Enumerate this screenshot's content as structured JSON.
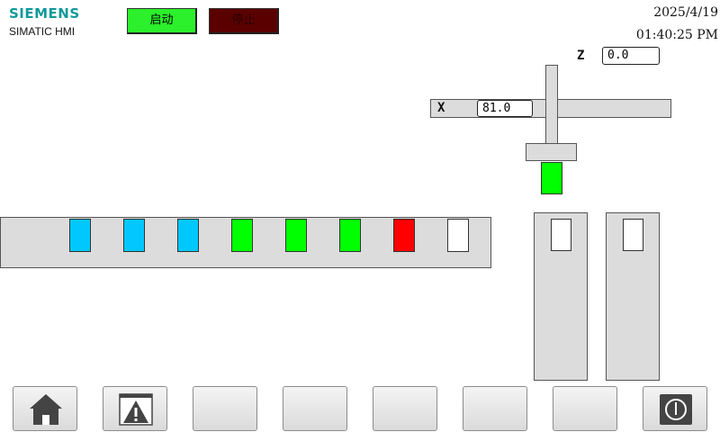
{
  "header": {
    "brand": "SIEMENS",
    "subbrand": "SIMATIC HMI",
    "start_label": "启动",
    "stop_label": "停止",
    "date": "2025/4/19",
    "time": "01:40:25 PM"
  },
  "axes": {
    "z_label": "Z",
    "z_value": "0.0",
    "x_label": "X",
    "x_value": "81.0"
  },
  "conveyor": {
    "items": [
      {
        "color": "#00c8ff"
      },
      {
        "color": "#00c8ff"
      },
      {
        "color": "#00c8ff"
      },
      {
        "color": "#00ff00"
      },
      {
        "color": "#00ff00"
      },
      {
        "color": "#00ff00"
      },
      {
        "color": "#ff0000"
      },
      {
        "color": "#ffffff"
      }
    ]
  },
  "gripper": {
    "held_color": "#00ff00"
  },
  "bins": [
    {
      "slot_color": "#ffffff"
    },
    {
      "slot_color": "#ffffff"
    }
  ],
  "nav": {
    "buttons": [
      {
        "icon": "home-icon"
      },
      {
        "icon": "warning-icon"
      },
      {
        "icon": ""
      },
      {
        "icon": ""
      },
      {
        "icon": ""
      },
      {
        "icon": ""
      },
      {
        "icon": ""
      },
      {
        "icon": "power-icon"
      }
    ]
  },
  "colors": {
    "brand": "#0f9a9a",
    "start": "#2bf02b",
    "stop": "#5a0000",
    "panel": "#dcdcdc"
  }
}
